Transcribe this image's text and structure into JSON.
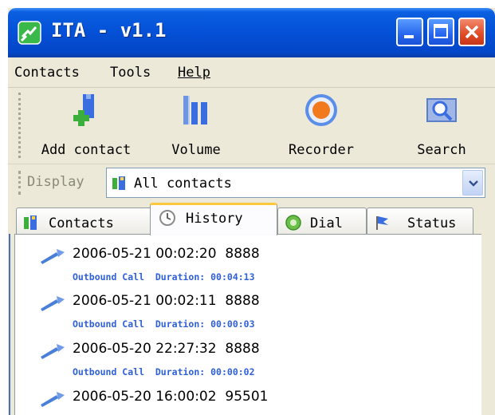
{
  "window": {
    "title": "ITA - v1.1"
  },
  "menu": {
    "items": [
      {
        "label": "Contacts"
      },
      {
        "label": "Tools"
      },
      {
        "label": "Help",
        "mnemonic": "H"
      }
    ]
  },
  "toolbar": {
    "items": [
      {
        "label": "Add contact",
        "icon": "add-contact-icon"
      },
      {
        "label": "Volume",
        "icon": "volume-icon"
      },
      {
        "label": "Recorder",
        "icon": "recorder-icon"
      },
      {
        "label": "Search",
        "icon": "search-icon"
      }
    ]
  },
  "display": {
    "label": "Display",
    "value": "All contacts"
  },
  "tabs": [
    {
      "label": "Contacts",
      "icon": "contacts-icon"
    },
    {
      "label": "History",
      "icon": "clock-icon",
      "active": true
    },
    {
      "label": "Dial",
      "icon": "dial-icon"
    },
    {
      "label": "Status",
      "icon": "flag-icon"
    }
  ],
  "history": [
    {
      "datetime": "2006-05-21 00:02:20",
      "number": "8888",
      "type": "Outbound Call",
      "duration_label": "Duration:",
      "duration": "00:04:13"
    },
    {
      "datetime": "2006-05-21 00:02:11",
      "number": "8888",
      "type": "Outbound Call",
      "duration_label": "Duration:",
      "duration": "00:00:03"
    },
    {
      "datetime": "2006-05-20 22:27:32",
      "number": "8888",
      "type": "Outbound Call",
      "duration_label": "Duration:",
      "duration": "00:00:02"
    },
    {
      "datetime": "2006-05-20 16:00:02",
      "number": "95501",
      "type": "",
      "duration_label": "",
      "duration": ""
    }
  ],
  "colors": {
    "titlebar": "#0450d6",
    "close_button": "#e04a24",
    "history_subtext": "#2f60d8",
    "active_tab_accent": "#ffc83c"
  }
}
